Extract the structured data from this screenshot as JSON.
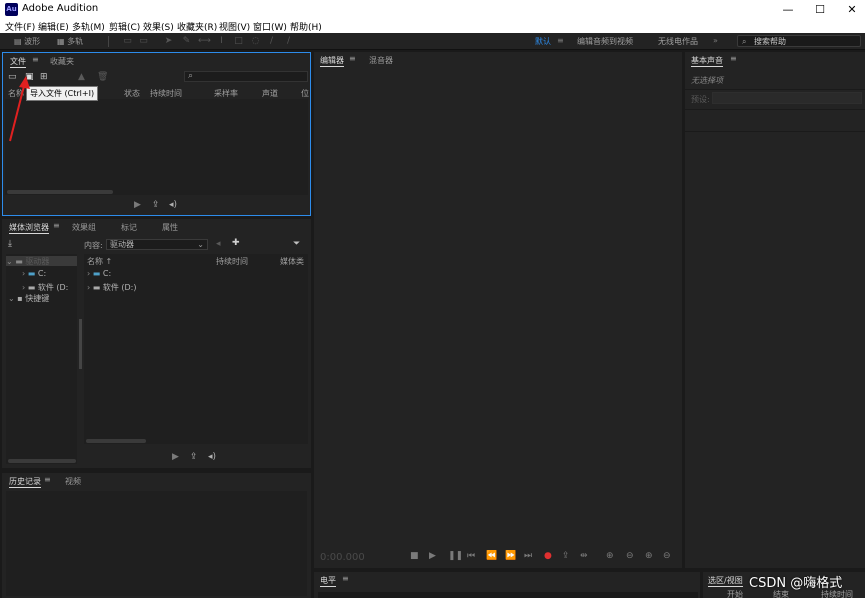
{
  "window": {
    "app_icon_text": "Au",
    "title": "Adobe Audition",
    "minimize": "—",
    "maximize": "☐",
    "close": "✕"
  },
  "menu": [
    "文件(F)",
    "编辑(E)",
    "多轨(M)",
    "剪辑(C)",
    "效果(S)",
    "收藏夹(R)",
    "视图(V)",
    "窗口(W)",
    "帮助(H)"
  ],
  "toolbar": {
    "waveform_label": "波形",
    "multitrack_label": "多轨",
    "workspaces": [
      "默认",
      "编辑音频到视频",
      "无线电作品"
    ],
    "help_search_placeholder": "搜索帮助"
  },
  "files_panel": {
    "tabs": [
      "文件",
      "收藏夹"
    ],
    "columns": [
      "名称",
      "状态",
      "持续时间",
      "采样率",
      "声道",
      "位"
    ],
    "tooltip": "导入文件 (Ctrl+I)"
  },
  "media_browser": {
    "tabs": [
      "媒体浏览器",
      "效果组",
      "标记",
      "属性"
    ],
    "content_label": "内容:",
    "content_value": "驱动器",
    "tree": [
      "驱动器",
      "C:",
      "软件 (D:",
      "快捷键"
    ],
    "columns": [
      "名称",
      "持续时间",
      "媒体类"
    ],
    "list": [
      "C:",
      "软件 (D:)"
    ]
  },
  "history_panel": {
    "tabs": [
      "历史记录",
      "视频"
    ]
  },
  "editor": {
    "tabs": [
      "编辑器",
      "混音器"
    ],
    "timecode": "0:00.000"
  },
  "levels": {
    "tab": "电平"
  },
  "essential_sound": {
    "tab": "基本声音",
    "no_selection": "无选择项",
    "preset_label": "预设:"
  },
  "selection_view": {
    "tab": "选区/视图",
    "col_start": "开始",
    "col_end": "结束",
    "col_duration": "持续时间"
  },
  "watermark": "CSDN @嗨格式"
}
